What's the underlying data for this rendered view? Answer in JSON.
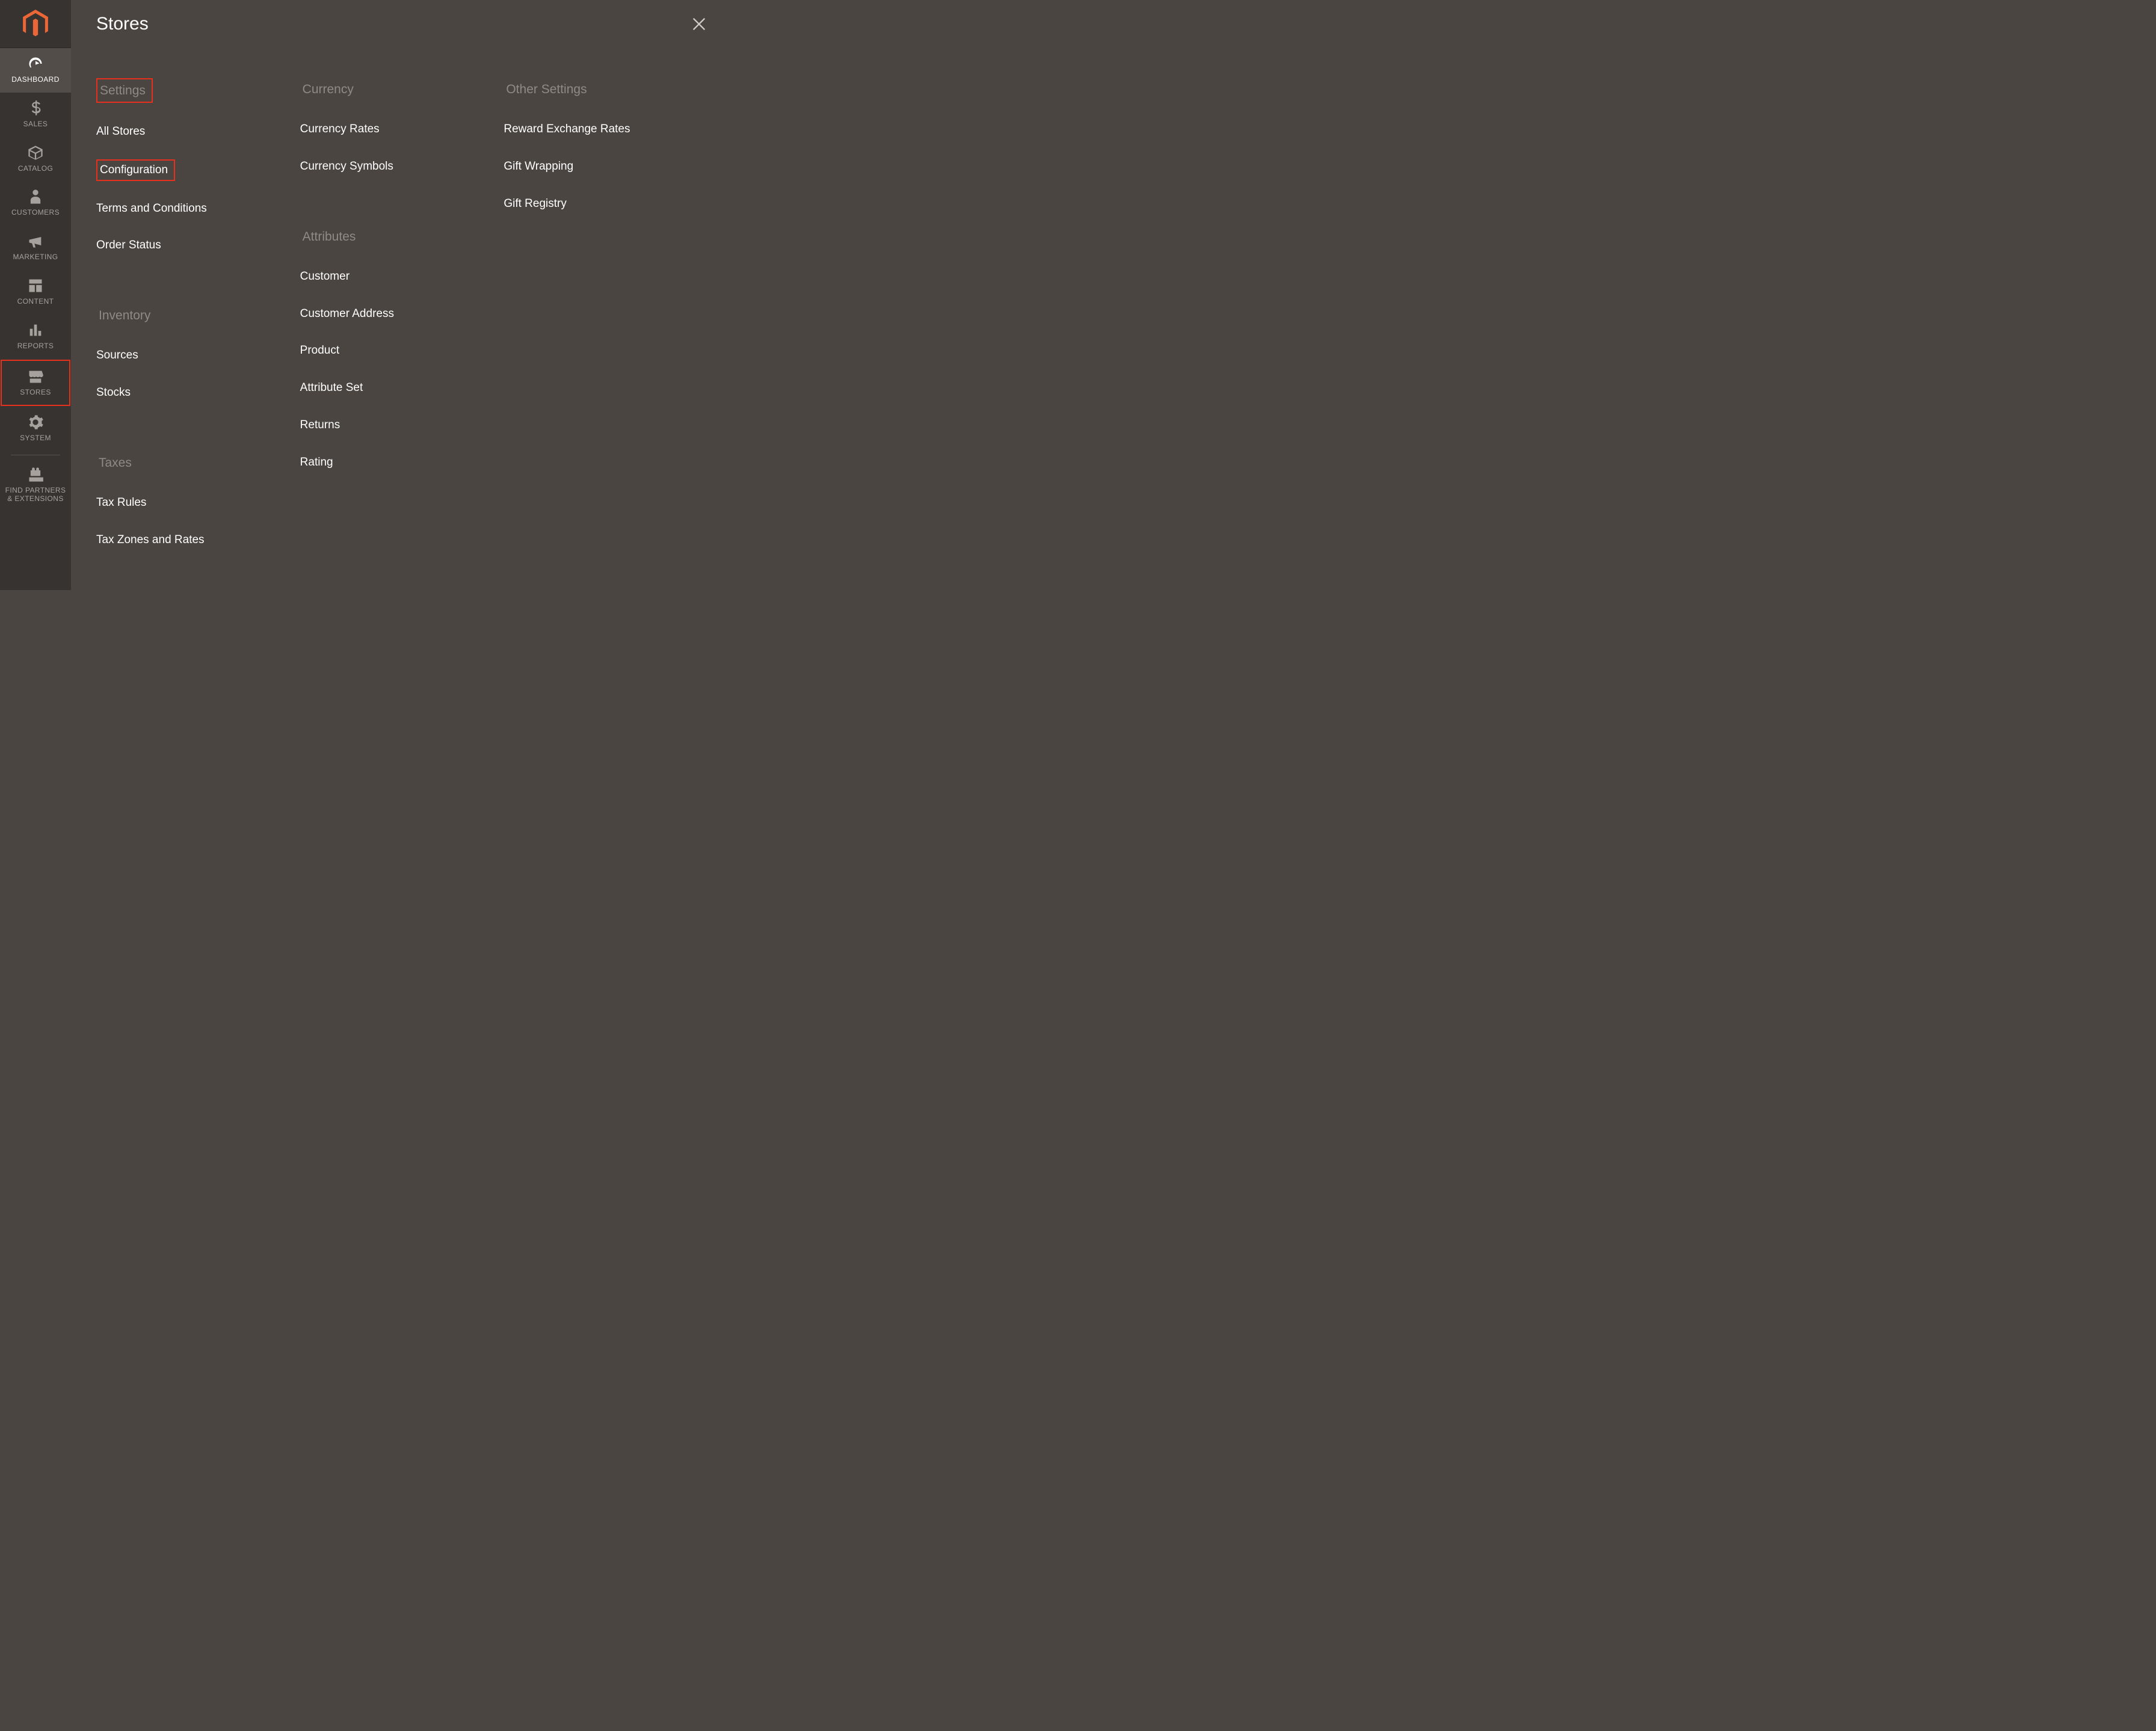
{
  "sidebar": {
    "items": [
      {
        "label": "DASHBOARD"
      },
      {
        "label": "SALES"
      },
      {
        "label": "CATALOG"
      },
      {
        "label": "CUSTOMERS"
      },
      {
        "label": "MARKETING"
      },
      {
        "label": "CONTENT"
      },
      {
        "label": "REPORTS"
      },
      {
        "label": "STORES"
      },
      {
        "label": "SYSTEM"
      },
      {
        "label": "FIND PARTNERS & EXTENSIONS"
      }
    ]
  },
  "flyout": {
    "title": "Stores",
    "columns": [
      {
        "sections": [
          {
            "heading": "Settings",
            "boxed_heading": true,
            "links": [
              {
                "label": "All Stores"
              },
              {
                "label": "Configuration",
                "boxed": true
              },
              {
                "label": "Terms and Conditions"
              },
              {
                "label": "Order Status"
              }
            ]
          },
          {
            "heading": "Inventory",
            "links": [
              {
                "label": "Sources"
              },
              {
                "label": "Stocks"
              }
            ]
          },
          {
            "heading": "Taxes",
            "links": [
              {
                "label": "Tax Rules"
              },
              {
                "label": "Tax Zones and Rates"
              }
            ]
          }
        ]
      },
      {
        "sections": [
          {
            "heading": "Currency",
            "links": [
              {
                "label": "Currency Rates"
              },
              {
                "label": "Currency Symbols"
              }
            ]
          },
          {
            "heading": "Attributes",
            "links": [
              {
                "label": "Customer"
              },
              {
                "label": "Customer Address"
              },
              {
                "label": "Product"
              },
              {
                "label": "Attribute Set"
              },
              {
                "label": "Returns"
              },
              {
                "label": "Rating"
              }
            ]
          }
        ]
      },
      {
        "sections": [
          {
            "heading": "Other Settings",
            "links": [
              {
                "label": "Reward Exchange Rates"
              },
              {
                "label": "Gift Wrapping"
              },
              {
                "label": "Gift Registry"
              }
            ]
          }
        ]
      }
    ]
  }
}
